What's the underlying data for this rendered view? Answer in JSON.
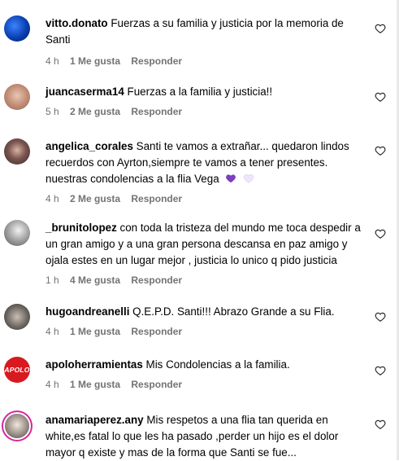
{
  "comments": [
    {
      "user": "vitto.donato",
      "text": "Fuerzas a su familia y justicia por la memoria de Santi",
      "time": "4 h",
      "likes": "1 Me gusta",
      "reply": "Responder"
    },
    {
      "user": "juancaserma14",
      "text": "Fuerzas a la familia y justicia!!",
      "time": "5 h",
      "likes": "2 Me gusta",
      "reply": "Responder"
    },
    {
      "user": "angelica_corales",
      "text": "Santi te vamos a extrañar... quedaron lindos recuerdos con Ayrton,siempre te vamos a tener presentes. nuestras condolencias a la flia Vega",
      "time": "4 h",
      "likes": "2 Me gusta",
      "reply": "Responder"
    },
    {
      "user": "_brunitolopez",
      "text": "con toda la tristeza del mundo me toca despedir a un gran amigo y a una gran persona descansa en paz amigo y ojala estes en un lugar mejor , justicia lo unico q pido justicia",
      "time": "1 h",
      "likes": "4 Me gusta",
      "reply": "Responder"
    },
    {
      "user": "hugoandreanelli",
      "text": "Q.E.P.D. Santi!!! Abrazo Grande a su Flia.",
      "time": "4 h",
      "likes": "1 Me gusta",
      "reply": "Responder"
    },
    {
      "user": "apoloherramientas",
      "text": "Mis Condolencias a la familia.",
      "time": "4 h",
      "likes": "1 Me gusta",
      "reply": "Responder"
    },
    {
      "user": "anamariaperez.any",
      "text": "Mis respetos a una flia tan querida en white,es fatal lo que les ha pasado ,perder un hijo es el dolor mayor q existe y mas de la forma que Santi se fue...",
      "time": "",
      "likes": "",
      "reply": ""
    }
  ],
  "icons": {
    "like": "heart-outline-icon",
    "emoji_1": "purple-heart-emoji",
    "emoji_2": "white-heart-emoji"
  },
  "logo_apolo": "APOLO"
}
